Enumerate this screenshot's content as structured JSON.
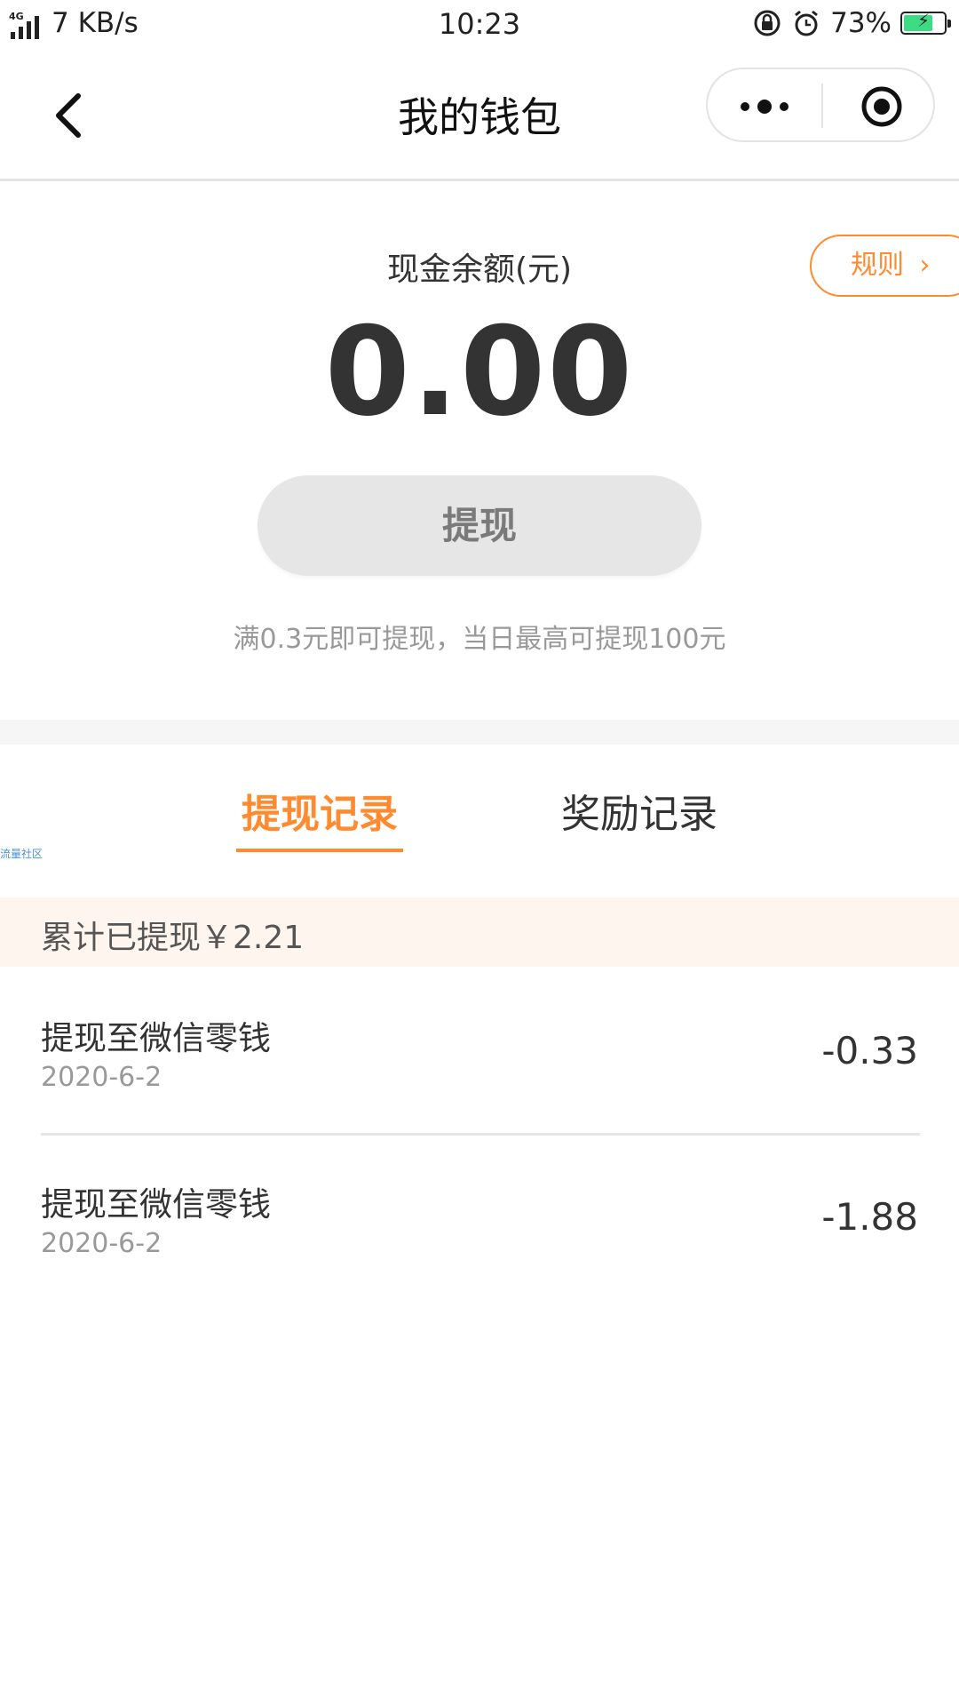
{
  "status_bar": {
    "network": "4G",
    "speed": "7 KB/s",
    "time": "10:23",
    "battery": "73%",
    "battery_level": 0.73,
    "icons": [
      "lock-rotation-icon",
      "alarm-icon",
      "battery-charging-icon"
    ]
  },
  "nav": {
    "title": "我的钱包",
    "icons": [
      "back-arrow-icon",
      "more-dots-icon",
      "target-icon"
    ]
  },
  "balance": {
    "label": "现金余额(元)",
    "value": "0.00",
    "rule_button": "规则",
    "rule_chevron": "›",
    "withdraw_button": "提现",
    "note": "满0.3元即可提现，当日最高可提现100元"
  },
  "tabs": [
    {
      "label": "提现记录",
      "active": true
    },
    {
      "label": "奖励记录",
      "active": false
    }
  ],
  "watermark": "流量社区",
  "summary": "累计已提现￥2.21",
  "records": [
    {
      "title": "提现至微信零钱",
      "date": "2020-6-2",
      "amount": "-0.33"
    },
    {
      "title": "提现至微信零钱",
      "date": "2020-6-2",
      "amount": "-1.88"
    }
  ],
  "colors": {
    "accent": "#ff8a30",
    "summary_bg": "#fff5ef",
    "button_bg": "#e6e6e6"
  }
}
